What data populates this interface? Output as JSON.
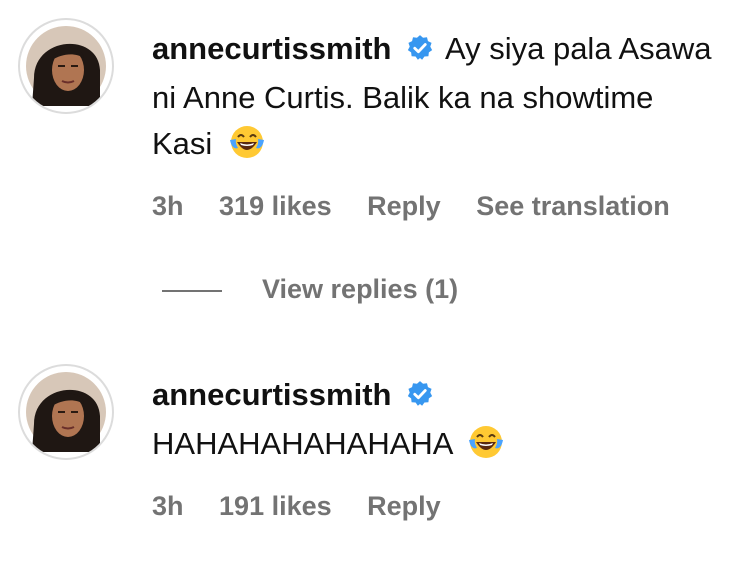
{
  "comments": [
    {
      "username": "annecurtissmith",
      "verified": true,
      "text": "Ay siya pala Asawa ni Anne Curtis. Balik ka na showtime Kasi",
      "emoji": "laughing-tears-emoji",
      "time": "3h",
      "likes": "319 likes",
      "reply_label": "Reply",
      "translation_label": "See translation"
    },
    {
      "username": "annecurtissmith",
      "verified": true,
      "text": "HAHAHAHAHAHAHA",
      "emoji": "laughing-tears-emoji",
      "time": "3h",
      "likes": "191 likes",
      "reply_label": "Reply"
    }
  ],
  "view_replies_label": "View replies (1)",
  "colors": {
    "verified_blue": "#3797f0",
    "meta_gray": "#737373",
    "emoji_yellow": "#ffc933",
    "emoji_tear": "#4aa3ff"
  }
}
